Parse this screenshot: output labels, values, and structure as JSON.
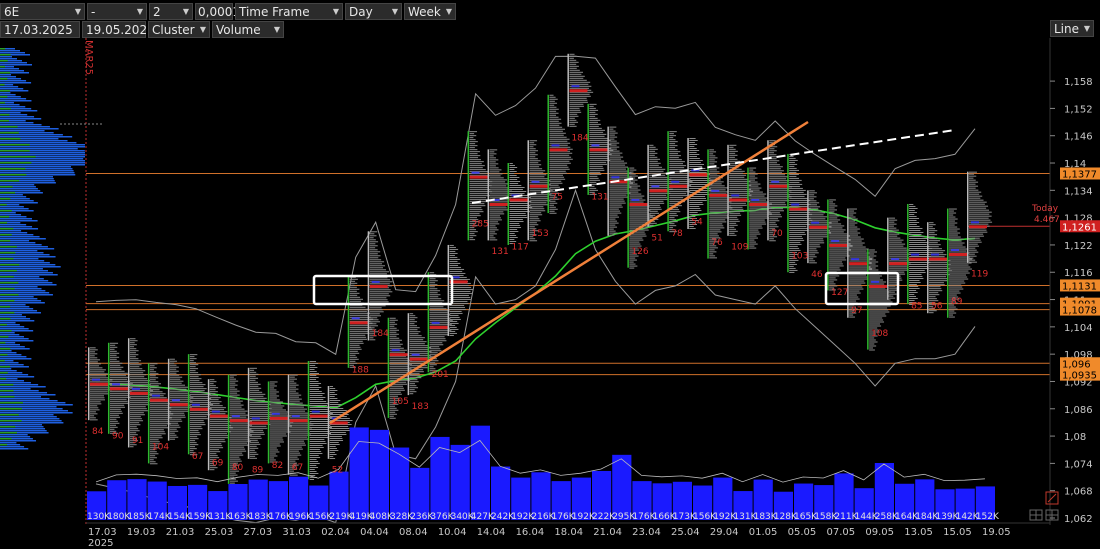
{
  "toolbar": {
    "symbol": "6E",
    "dash": "-",
    "number": "2",
    "tick": "0,0001",
    "timeframe_label": "Time Frame",
    "period": "Day",
    "range": "Week",
    "date_from": "17.03.2025",
    "date_to": "19.05.2025",
    "chart_mode": "Cluster",
    "cluster_mode": "Volume",
    "style": "Line"
  },
  "chart_data": {
    "type": "candlestick-cluster",
    "y_axis": {
      "min": 1.062,
      "max": 1.16,
      "ticks": [
        "1,158",
        "1,152",
        "1,146",
        "1,14",
        "1,134",
        "1,128",
        "1,122",
        "1,116",
        "1,11",
        "1,104",
        "1,098",
        "1,092",
        "1,086",
        "1,08",
        "1,074",
        "1,068",
        "1,062"
      ]
    },
    "price_tags": [
      {
        "label": "1,1377",
        "price": 1.1377
      },
      {
        "label": "1,1261",
        "price": 1.1261
      },
      {
        "label": "1,1131",
        "price": 1.1131
      },
      {
        "label": "1,1091",
        "price": 1.1091
      },
      {
        "label": "1,1078",
        "price": 1.1078
      },
      {
        "label": "1,096",
        "price": 1.096
      },
      {
        "label": "1,0935",
        "price": 1.0935
      }
    ],
    "today": {
      "label": "Today",
      "value": "4.467"
    },
    "vertical_marker": "MAR25",
    "x_dates": [
      "17.03",
      "19.03",
      "21.03",
      "25.03",
      "27.03",
      "31.03",
      "02.04",
      "04.04",
      "08.04",
      "10.04",
      "14.04",
      "16.04",
      "18.04",
      "21.04",
      "23.04",
      "25.04",
      "29.04",
      "01.05",
      "05.05",
      "07.05",
      "09.05",
      "13.05",
      "15.05",
      "19.05"
    ],
    "x_year": "2025",
    "volumes": [
      "130K",
      "180K",
      "185K",
      "174K",
      "154K",
      "159K",
      "131K",
      "163K",
      "183K",
      "176K",
      "196K",
      "156K",
      "219K",
      "419K",
      "408K",
      "328K",
      "236K",
      "376K",
      "340K",
      "427K",
      "242K",
      "192K",
      "216K",
      "176K",
      "192K",
      "222K",
      "295K",
      "176K",
      "166K",
      "173K",
      "156K",
      "192K",
      "131K",
      "183K",
      "128K",
      "165K",
      "158K",
      "211K",
      "144K",
      "258K",
      "164K",
      "184K",
      "139K",
      "142K",
      "152K"
    ],
    "volume_values": [
      130,
      180,
      185,
      174,
      154,
      159,
      131,
      163,
      183,
      176,
      196,
      156,
      219,
      419,
      408,
      328,
      236,
      376,
      340,
      427,
      242,
      192,
      216,
      176,
      192,
      222,
      295,
      176,
      166,
      173,
      156,
      192,
      131,
      183,
      128,
      165,
      158,
      211,
      144,
      258,
      164,
      184,
      139,
      142,
      152
    ],
    "closes": [
      1.0915,
      1.0905,
      1.0895,
      1.088,
      1.087,
      1.086,
      1.0845,
      1.0835,
      1.083,
      1.084,
      1.0835,
      1.0845,
      1.083,
      1.105,
      1.113,
      1.098,
      1.097,
      1.104,
      1.114,
      1.137,
      1.131,
      1.132,
      1.135,
      1.143,
      1.156,
      1.143,
      1.136,
      1.131,
      1.134,
      1.135,
      1.1375,
      1.133,
      1.132,
      1.131,
      1.135,
      1.13,
      1.126,
      1.122,
      1.118,
      1.113,
      1.118,
      1.119,
      1.119,
      1.12,
      1.1261
    ],
    "counts": [
      "84",
      "90",
      "91",
      "104",
      "67",
      "69",
      "80",
      "89",
      "82",
      "67",
      "52",
      "188",
      "184",
      "105",
      "183",
      "201",
      "285",
      "131",
      "117",
      "153",
      "75",
      "184",
      "131",
      "126",
      "51",
      "78",
      "54",
      "76",
      "109",
      "70",
      "103",
      "46",
      "127",
      "97",
      "108",
      "85",
      "56",
      "89",
      "119"
    ]
  }
}
